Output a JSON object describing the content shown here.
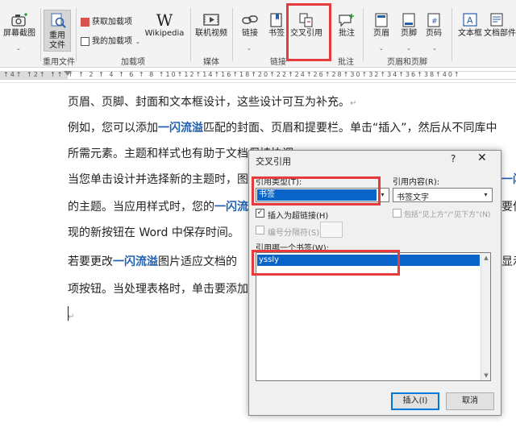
{
  "ribbon": {
    "screenshot_label": "屏幕截图",
    "reuse_files_label": "重用\n文件",
    "reuse_group": "重用文件",
    "get_addins": "获取加载项",
    "my_addins": "我的加载项",
    "wikipedia": "Wikipedia",
    "wikipedia_logo": "W",
    "addins_group": "加载项",
    "online_video": "联机视频",
    "media_group": "媒体",
    "link": "链接",
    "bookmark": "书签",
    "cross_ref": "交叉引用",
    "links_group": "链接",
    "comment": "批注",
    "comment_group": "批注",
    "header": "页眉",
    "footer": "页脚",
    "page_number": "页码",
    "header_footer_group": "页眉和页脚",
    "textbox": "文本框",
    "doc_parts": "文档部件"
  },
  "ruler": {
    "numbers": "↑4↑ ↑2↑ ↑↑ ↑ ↑ 2 ↑ 4 ↑ 6 ↑ 8 ↑10↑12↑14↑16↑18↑20↑22↑24↑26↑28↑30↑32↑34↑36↑38↑40↑"
  },
  "document": {
    "lines": [
      {
        "pre": "页眉、页脚、封面和文本框设计，这些设计可互为补充。",
        "hl": "",
        "post": "",
        "mark": "↵"
      },
      {
        "pre": "例如，您可以添加",
        "hl": "一闪流溢",
        "post": "匹配的封面、页眉和提要栏。单击“插入”，然后从不同库中",
        "mark": ""
      },
      {
        "pre": "所需元素。主题和样式也有助于文档保持协调。",
        "hl": "",
        "post": "",
        "mark": ""
      },
      {
        "pre": "当您单击设计并选择新的主题时，图",
        "hl": "",
        "post": "",
        "mark": ""
      },
      {
        "pre": "的主题。当应用样式时，您的",
        "hl": "一闪流",
        "post": "",
        "mark": ""
      },
      {
        "pre": "现的新按钮在 Word 中保存时间。",
        "hl": "",
        "post": "",
        "mark": ""
      },
      {
        "pre": "若要更改",
        "hl": "一闪流溢",
        "post": "图片适应文档的",
        "mark": ""
      },
      {
        "pre": "项按钮。当处理表格时，单击要添加",
        "hl": "",
        "post": "",
        "mark": ""
      },
      {
        "pre": "",
        "hl": "",
        "post": "",
        "mark": "↵"
      }
    ],
    "right_fragments": {
      "line4": "一闪",
      "line5": "要使",
      "line7": "显示在"
    }
  },
  "dialog": {
    "title": "交叉引用",
    "help": "?",
    "close": "✕",
    "ref_type_label": "引用类型(T):",
    "ref_type_value": "书签",
    "ref_content_label": "引用内容(R):",
    "ref_content_value": "书签文字",
    "insert_hyperlink_label": "插入为超链接(H)",
    "insert_hyperlink_checked": true,
    "include_above_below_label": "包括“见上方”/“见下方”(N)",
    "separate_numbers_label": "编号分隔符(S)",
    "which_bookmark_label": "引用哪一个书签(W):",
    "bookmarks": [
      "yssly"
    ],
    "insert_button": "插入(I)",
    "cancel_button": "取消"
  },
  "colors": {
    "highlight_text": "#1f5fb0",
    "selection": "#0a64c8",
    "annotation": "#e83a3a"
  }
}
